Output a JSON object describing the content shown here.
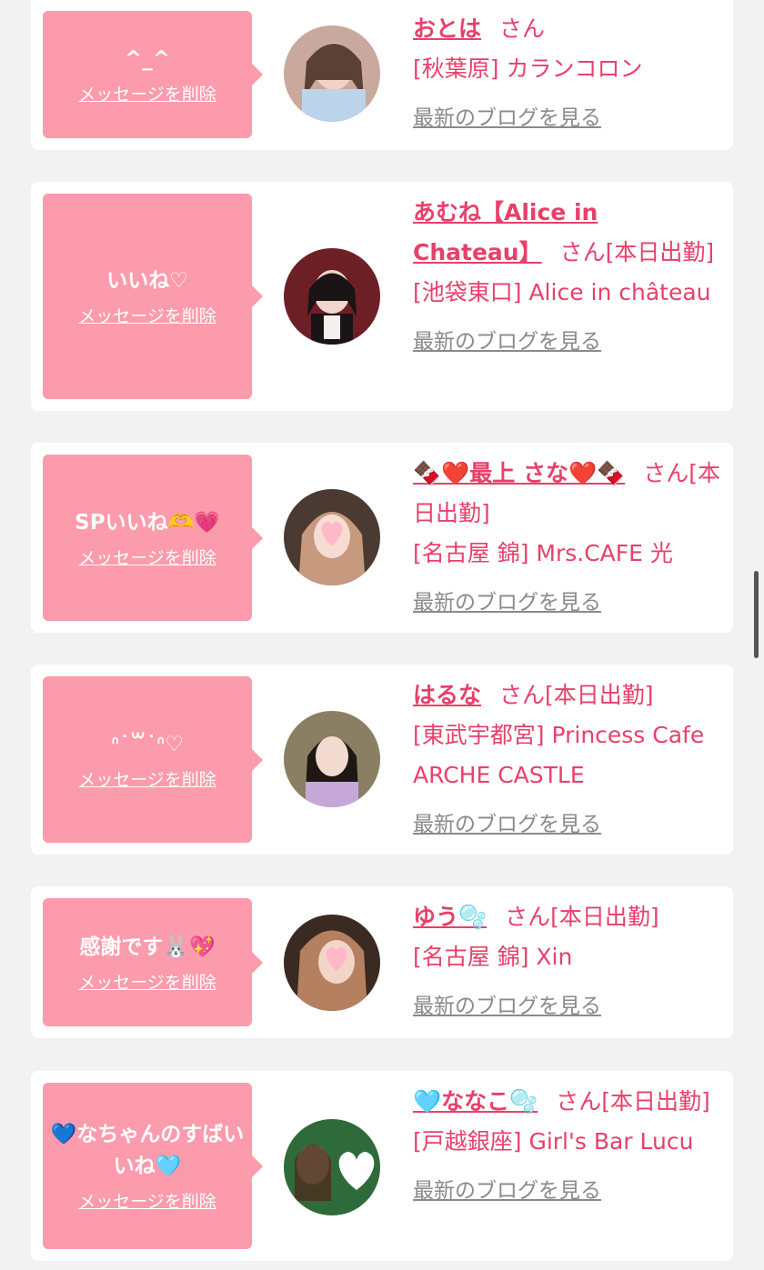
{
  "items": [
    {
      "message": "^_^",
      "delete_label": "メッセージを削除",
      "name": "おとは",
      "san": "さん",
      "status": "",
      "shop": "[秋葉原] カランコロン",
      "blog_label": "最新のブログを見る"
    },
    {
      "message": "いいね♡",
      "delete_label": "メッセージを削除",
      "name": "あむね【Alice in Chateau】",
      "san": "さん",
      "status": "[本日出勤]",
      "shop": "[池袋東口] Alice in château",
      "blog_label": "最新のブログを見る"
    },
    {
      "message": "SPいいね🫶💗",
      "delete_label": "メッセージを削除",
      "name": "🍫❤️最上 さな❤️🍫",
      "san": "さん",
      "status": "[本日出勤]",
      "shop": "[名古屋 錦] Mrs.CAFE 光",
      "blog_label": "最新のブログを見る"
    },
    {
      "message": "ᐢ˙꒳˙ᐢ♡",
      "delete_label": "メッセージを削除",
      "name": "はるな",
      "san": "さん",
      "status": "[本日出勤]",
      "shop": "[東武宇都宮] Princess Cafe ARCHE CASTLE",
      "blog_label": "最新のブログを見る"
    },
    {
      "message": "感謝です🐰💖",
      "delete_label": "メッセージを削除",
      "name": "ゆう🫧",
      "san": "さん",
      "status": "[本日出勤]",
      "shop": "[名古屋 錦] Xin",
      "blog_label": "最新のブログを見る"
    },
    {
      "message": "💙なちゃんのすばいいね🩵",
      "delete_label": "メッセージを削除",
      "name": "🩵ななこ🫧",
      "san": "さん",
      "status": "[本日出勤]",
      "shop": "[戸越銀座] Girl's Bar Lucu",
      "blog_label": "最新のブログを見る"
    }
  ],
  "colors": {
    "bubble": "#fc9bab",
    "accent": "#e8406a",
    "link_gray": "#8a8a8a",
    "background": "#f2f2f2",
    "card": "#ffffff"
  }
}
